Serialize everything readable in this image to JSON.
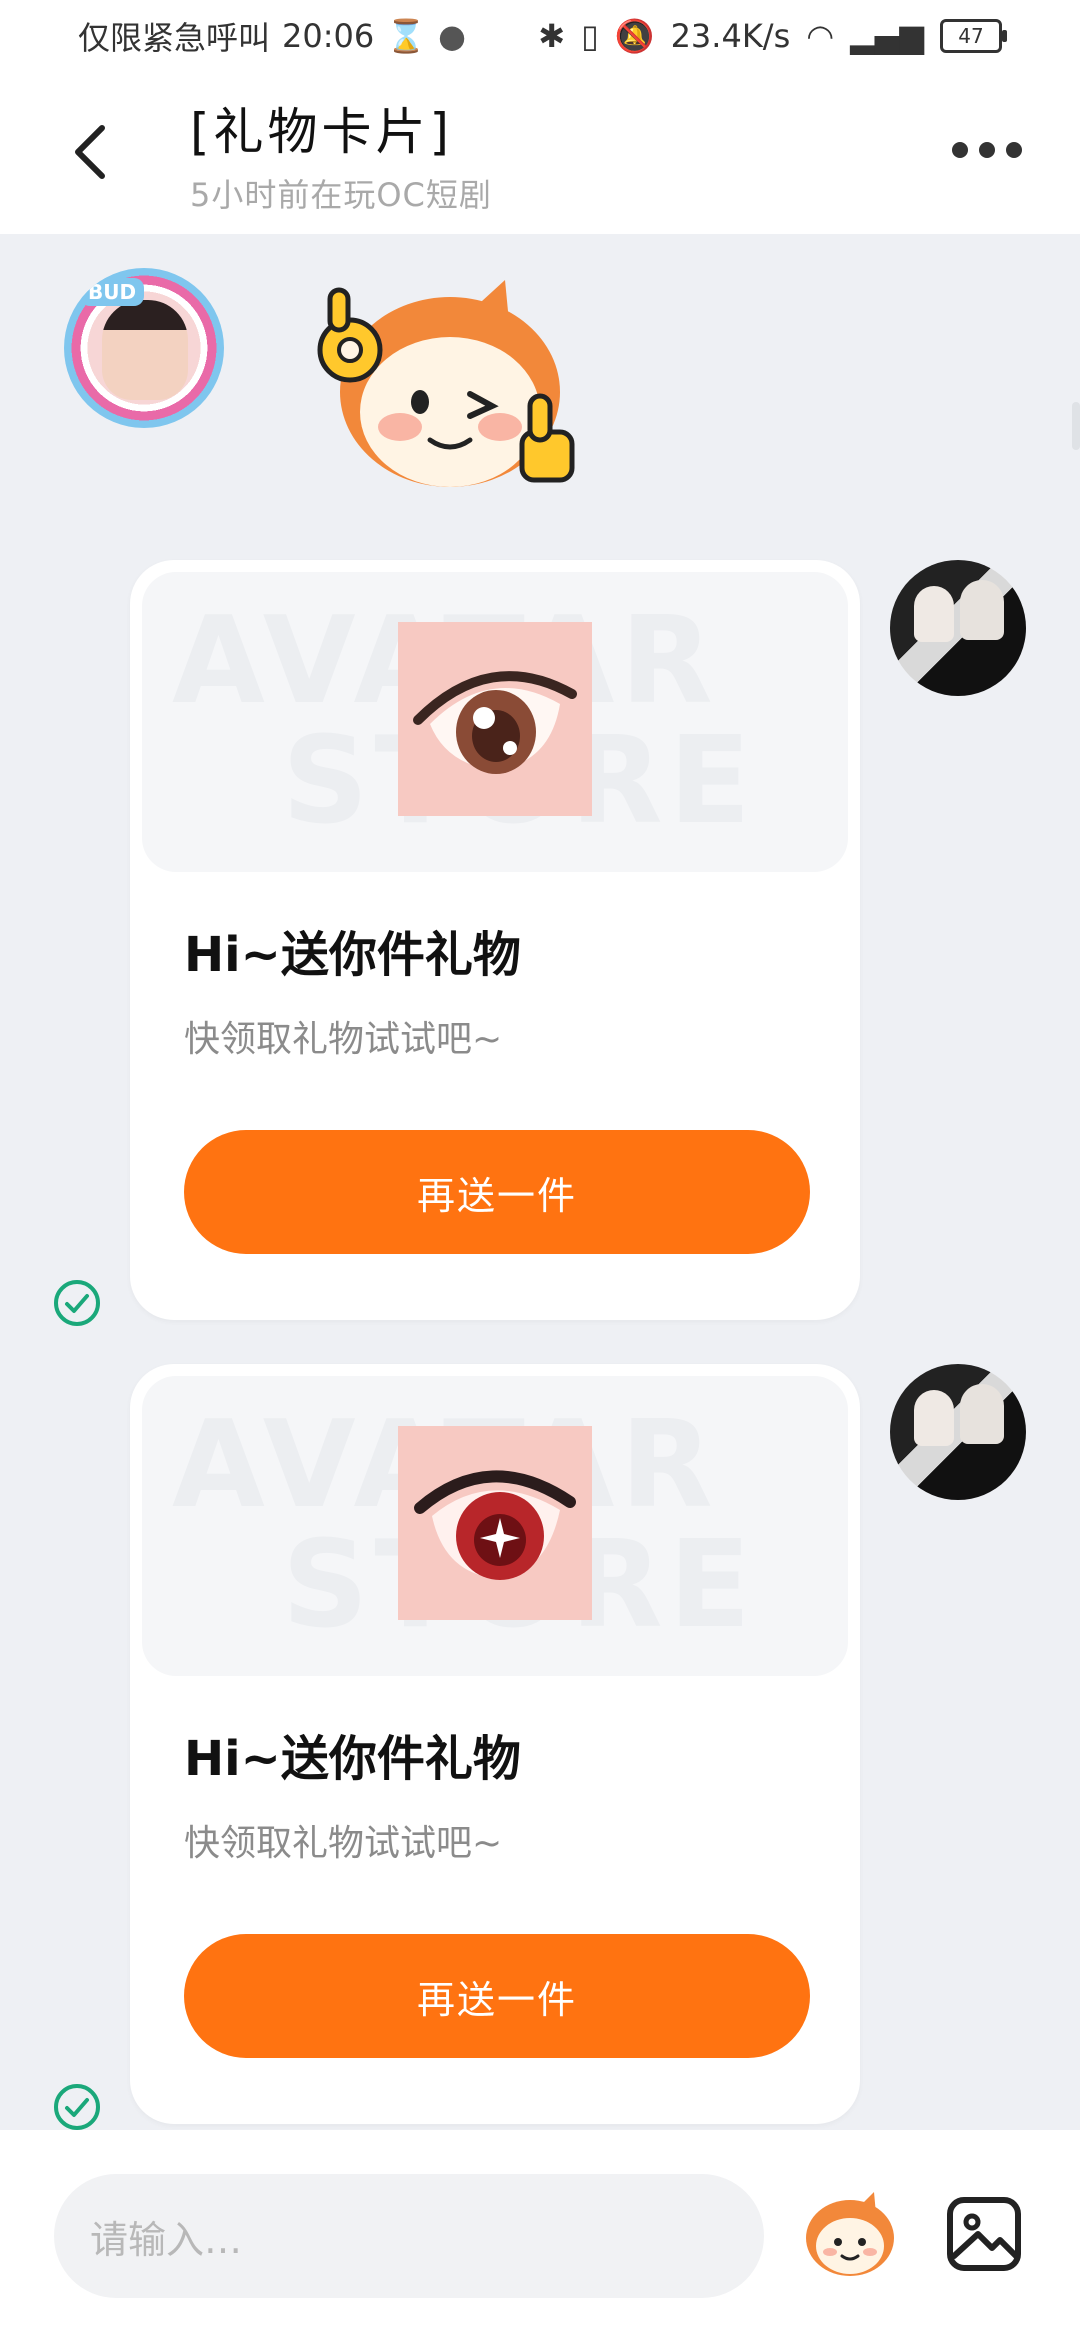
{
  "status_bar": {
    "left_text": "仅限紧急呼叫",
    "time": "20:06",
    "network_speed": "23.4K/s",
    "battery_level": "47"
  },
  "header": {
    "title": "[礼物卡片]",
    "subtitle": "5小时前在玩OC短剧"
  },
  "messages": [
    {
      "type": "sticker",
      "sender": "other",
      "sticker_icon": "mascot-ok-thumbs-up-sticker"
    },
    {
      "type": "gift_card",
      "sender": "self",
      "watermark_line1": "AVATAR",
      "watermark_line2": "STORE",
      "gift_icon": "anime-eye-brown",
      "title": "Hi~送你件礼物",
      "subtitle": "快领取礼物试试吧~",
      "button_label": "再送一件",
      "status": "read"
    },
    {
      "type": "gift_card",
      "sender": "self",
      "watermark_line1": "AVATAR",
      "watermark_line2": "STORE",
      "gift_icon": "anime-eye-red",
      "title": "Hi~送你件礼物",
      "subtitle": "快领取礼物试试吧~",
      "button_label": "再送一件",
      "status": "read"
    }
  ],
  "input_bar": {
    "placeholder": "请输入…"
  },
  "colors": {
    "accent": "#ff7311",
    "read_check": "#1aa87a",
    "chat_background": "#eef0f4"
  }
}
